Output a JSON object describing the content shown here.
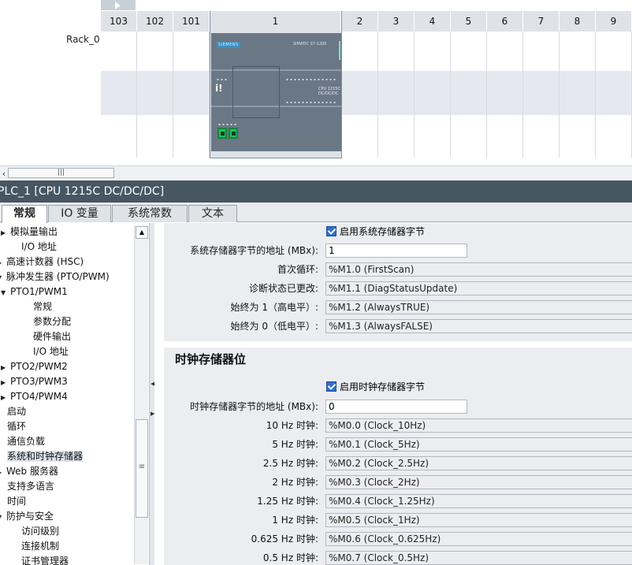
{
  "rack": {
    "name": "Rack_0",
    "slots": [
      "103",
      "102",
      "101",
      "1",
      "2",
      "3",
      "4",
      "5",
      "6",
      "7",
      "8",
      "9"
    ],
    "cpu": {
      "brand": "SIEMENS",
      "model": "SIMATIC S7-1200",
      "side_text": [
        "CPU 1215C",
        "DC/DC/DC"
      ]
    }
  },
  "scrollbar": {
    "left_arrow": "‹",
    "thumb_grip": "|||"
  },
  "properties": {
    "title": "PLC_1 [CPU 1215C DC/DC/DC]",
    "tabs": [
      "常规",
      "IO 变量",
      "系统常数",
      "文本"
    ],
    "active_tab": 0
  },
  "tree": {
    "items": [
      {
        "label": "模拟量输出",
        "caret": "▶",
        "indent": 1
      },
      {
        "label": "I/O 地址",
        "caret": "",
        "indent": 2
      },
      {
        "label": "高速计数器 (HSC)",
        "caret": "▶",
        "indent": 0
      },
      {
        "label": "脉冲发生器 (PTO/PWM)",
        "caret": "▼",
        "indent": 0
      },
      {
        "label": "PTO1/PWM1",
        "caret": "▼",
        "indent": 1
      },
      {
        "label": "常规",
        "caret": "",
        "indent": 3
      },
      {
        "label": "参数分配",
        "caret": "",
        "indent": 3
      },
      {
        "label": "硬件输出",
        "caret": "",
        "indent": 3
      },
      {
        "label": "I/O 地址",
        "caret": "",
        "indent": 3
      },
      {
        "label": "PTO2/PWM2",
        "caret": "▶",
        "indent": 1
      },
      {
        "label": "PTO3/PWM3",
        "caret": "▶",
        "indent": 1
      },
      {
        "label": "PTO4/PWM4",
        "caret": "▶",
        "indent": 1
      },
      {
        "label": "启动",
        "caret": "",
        "indent": 0
      },
      {
        "label": "循环",
        "caret": "",
        "indent": 0
      },
      {
        "label": "通信负载",
        "caret": "",
        "indent": 0
      },
      {
        "label": "系统和时钟存储器",
        "caret": "",
        "indent": 0,
        "selected": true
      },
      {
        "label": "Web 服务器",
        "caret": "▶",
        "indent": 0
      },
      {
        "label": "支持多语言",
        "caret": "",
        "indent": 0
      },
      {
        "label": "时间",
        "caret": "",
        "indent": 0
      },
      {
        "label": "防护与安全",
        "caret": "▼",
        "indent": 0
      },
      {
        "label": "访问级别",
        "caret": "",
        "indent": 2
      },
      {
        "label": "连接机制",
        "caret": "",
        "indent": 2
      },
      {
        "label": "证书管理器",
        "caret": "",
        "indent": 2
      }
    ],
    "scroll_up": "▲",
    "scroll_grip": "≡"
  },
  "system_memory": {
    "enable_label": "启用系统存储器字节",
    "address_label": "系统存储器字节的地址 (MBx):",
    "address_value": "1",
    "rows": [
      {
        "label": "首次循环:",
        "value": "%M1.0 (FirstScan)"
      },
      {
        "label": "诊断状态已更改:",
        "value": "%M1.1 (DiagStatusUpdate)"
      },
      {
        "label": "始终为 1（高电平）:",
        "value": "%M1.2 (AlwaysTRUE)"
      },
      {
        "label": "始终为 0（低电平）:",
        "value": "%M1.3 (AlwaysFALSE)"
      }
    ]
  },
  "clock_memory": {
    "title": "时钟存储器位",
    "enable_label": "启用时钟存储器字节",
    "address_label": "时钟存储器字节的地址 (MBx):",
    "address_value": "0",
    "rows": [
      {
        "label": "10 Hz 时钟:",
        "value": "%M0.0 (Clock_10Hz)"
      },
      {
        "label": "5 Hz 时钟:",
        "value": "%M0.1 (Clock_5Hz)"
      },
      {
        "label": "2.5 Hz 时钟:",
        "value": "%M0.2 (Clock_2.5Hz)"
      },
      {
        "label": "2 Hz 时钟:",
        "value": "%M0.3 (Clock_2Hz)"
      },
      {
        "label": "1.25 Hz 时钟:",
        "value": "%M0.4 (Clock_1.25Hz)"
      },
      {
        "label": "1 Hz 时钟:",
        "value": "%M0.5 (Clock_1Hz)"
      },
      {
        "label": "0.625 Hz 时钟:",
        "value": "%M0.6 (Clock_0.625Hz)"
      },
      {
        "label": "0.5 Hz 时钟:",
        "value": "%M0.7 (Clock_0.5Hz)"
      }
    ]
  }
}
